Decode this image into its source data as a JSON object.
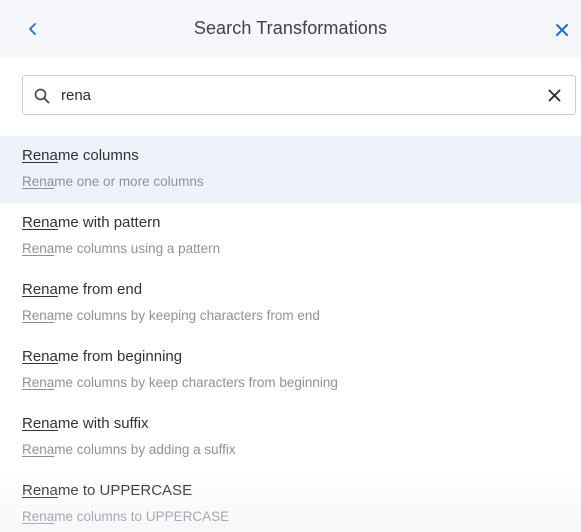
{
  "header": {
    "title": "Search Transformations",
    "back_icon": "chevron-left-icon",
    "close_icon": "close-icon",
    "accent_color": "#1f6fc5"
  },
  "search": {
    "value": "rena",
    "search_icon": "search-icon",
    "clear_icon": "clear-icon"
  },
  "results": [
    {
      "title_match": "Rena",
      "title_rest": "me columns",
      "desc_match": "Rena",
      "desc_rest": "me one or more columns",
      "highlighted": true
    },
    {
      "title_match": "Rena",
      "title_rest": "me with pattern",
      "desc_match": "Rena",
      "desc_rest": "me columns using a pattern",
      "highlighted": false
    },
    {
      "title_match": "Rena",
      "title_rest": "me from end",
      "desc_match": "Rena",
      "desc_rest": "me columns by keeping characters from end",
      "highlighted": false
    },
    {
      "title_match": "Rena",
      "title_rest": "me from beginning",
      "desc_match": "Rena",
      "desc_rest": "me columns by keep characters from beginning",
      "highlighted": false
    },
    {
      "title_match": "Rena",
      "title_rest": "me with suffix",
      "desc_match": "Rena",
      "desc_rest": "me columns by adding a suffix",
      "highlighted": false
    },
    {
      "title_match": "Rena",
      "title_rest": "me to UPPERCASE",
      "desc_match": "Rena",
      "desc_rest": "me columns to UPPERCASE",
      "highlighted": false
    }
  ]
}
